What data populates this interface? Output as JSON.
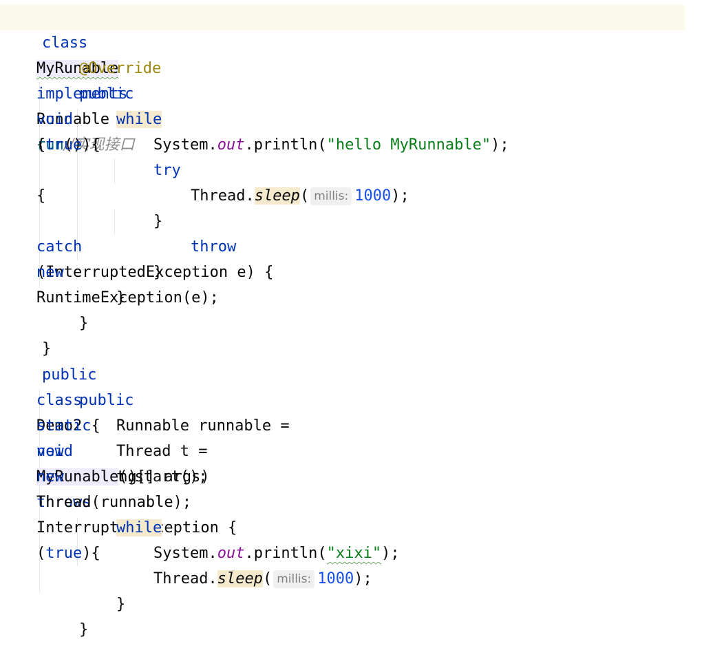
{
  "editor": {
    "lines": [
      {
        "kw_class": "class",
        "class_name": "MyRunable",
        "kw_implements": "implements",
        "iface": "Runnable",
        "brace": "{",
        "comment": "//实现接口"
      },
      {
        "annotation": "@Override"
      },
      {
        "kw_public": "public",
        "kw_void": "void",
        "method": "run",
        "rest": "() {"
      },
      {
        "kw_while": "while",
        "open": "(",
        "kw_true": "true",
        "close": "){"
      },
      {
        "receiver": "System.",
        "field": "out",
        "call": ".println(",
        "string": "\"hello MyRunnable\"",
        "end": ");"
      },
      {
        "kw_try": "try",
        "brace": "{"
      },
      {
        "receiver": "Thread.",
        "method": "sleep",
        "open": "(",
        "hint": "millis:",
        "number": "1000",
        "end": ");"
      },
      {
        "open": "}",
        "kw_catch": "catch",
        "rest": "(InterruptedException e) {"
      },
      {
        "kw_throw": "throw",
        "kw_new": "new",
        "rest": "RuntimeException(e);"
      },
      {
        "text": "}"
      },
      {
        "text": "}"
      },
      {
        "text": "}"
      },
      {
        "text": "}"
      },
      {
        "kw_public": "public",
        "kw_class": "class",
        "rest": "Demo2 {"
      },
      {
        "kw_public": "public",
        "kw_static": "static",
        "kw_void": "void",
        "method": "main",
        "params": "(String[] args)",
        "kw_throws": "throws",
        "rest": "InterruptedException {"
      },
      {
        "start": "Runnable runnable =",
        "kw_new": "new",
        "class_name": "MyRunable",
        "end": "();"
      },
      {
        "start": "Thread t =",
        "kw_new": "new",
        "end": "Thread(runnable);"
      },
      {
        "text": "t.start();"
      },
      {
        "kw_while": "while",
        "open": "(",
        "kw_true": "true",
        "close": "){"
      },
      {
        "receiver": "System.",
        "field": "out",
        "call": ".println(",
        "string": "\"xixi\"",
        "end": ");"
      },
      {
        "receiver": "Thread.",
        "method": "sleep",
        "open": "(",
        "hint": "millis:",
        "number": "1000",
        "end": ");"
      },
      {
        "text": "}"
      },
      {
        "text": "}"
      }
    ]
  }
}
